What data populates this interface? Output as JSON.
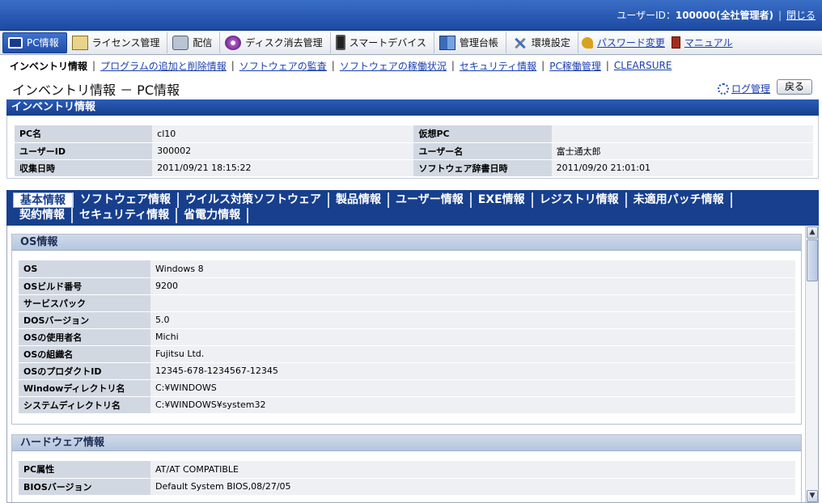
{
  "header": {
    "user_label": "ユーザーID：",
    "user_value": "100000(全社管理者)",
    "close_label": "閉じる"
  },
  "main_menu": {
    "items": [
      {
        "label": "PC情報",
        "icon": "pc-icon"
      },
      {
        "label": "ライセンス管理",
        "icon": "license-icon"
      },
      {
        "label": "配信",
        "icon": "distribution-icon"
      },
      {
        "label": "ディスク消去管理",
        "icon": "disk-icon"
      },
      {
        "label": "スマートデバイス",
        "icon": "smartphone-icon"
      },
      {
        "label": "管理台帳",
        "icon": "ledger-icon"
      },
      {
        "label": "環境設定",
        "icon": "tools-icon"
      }
    ],
    "password_label": "パスワード変更",
    "manual_label": "マニュアル"
  },
  "sub_menu": {
    "current": "インベントリ情報",
    "links": [
      "プログラムの追加と削除情報",
      "ソフトウェアの監査",
      "ソフトウェアの稼働状況",
      "セキュリティ情報",
      "PC稼働管理",
      "CLEARSURE"
    ]
  },
  "page": {
    "title": "インベントリ情報 － PC情報",
    "log_label": "ログ管理",
    "back_label": "戻る"
  },
  "inventory": {
    "section_title": "インベントリ情報",
    "rows": [
      {
        "k1": "PC名",
        "v1": "cl10",
        "k2": "仮想PC",
        "v2": ""
      },
      {
        "k1": "ユーザーID",
        "v1": "300002",
        "k2": "ユーザー名",
        "v2": "富士通太郎"
      },
      {
        "k1": "収集日時",
        "v1": "2011/09/21 18:15:22",
        "k2": "ソフトウェア辞書日時",
        "v2": "2011/09/20 21:01:01"
      }
    ]
  },
  "tabs": {
    "row1": [
      "基本情報",
      "ソフトウェア情報",
      "ウイルス対策ソフトウェア",
      "製品情報",
      "ユーザー情報",
      "EXE情報",
      "レジストリ情報",
      "未適用パッチ情報"
    ],
    "row2": [
      "契約情報",
      "セキュリティ情報",
      "省電力情報"
    ]
  },
  "os_info": {
    "title": "OS情報",
    "rows": [
      {
        "k": "OS",
        "v": "Windows 8"
      },
      {
        "k": "OSビルド番号",
        "v": "9200"
      },
      {
        "k": "サービスパック",
        "v": ""
      },
      {
        "k": "DOSバージョン",
        "v": "5.0"
      },
      {
        "k": "OSの使用者名",
        "v": "Michi"
      },
      {
        "k": "OSの組織名",
        "v": "Fujitsu Ltd."
      },
      {
        "k": "OSのプロダクトID",
        "v": "12345-678-1234567-12345"
      },
      {
        "k": "Windowディレクトリ名",
        "v": "C:¥WINDOWS"
      },
      {
        "k": "システムディレクトリ名",
        "v": "C:¥WINDOWS¥system32"
      }
    ]
  },
  "hw_info": {
    "title": "ハードウェア情報",
    "rows": [
      {
        "k": "PC属性",
        "v": "AT/AT COMPATIBLE"
      },
      {
        "k": "BIOSバージョン",
        "v": "Default System BIOS,08/27/05"
      }
    ]
  },
  "colors": {
    "brand_blue": "#173f8d",
    "link_blue": "#1a3fb0"
  }
}
